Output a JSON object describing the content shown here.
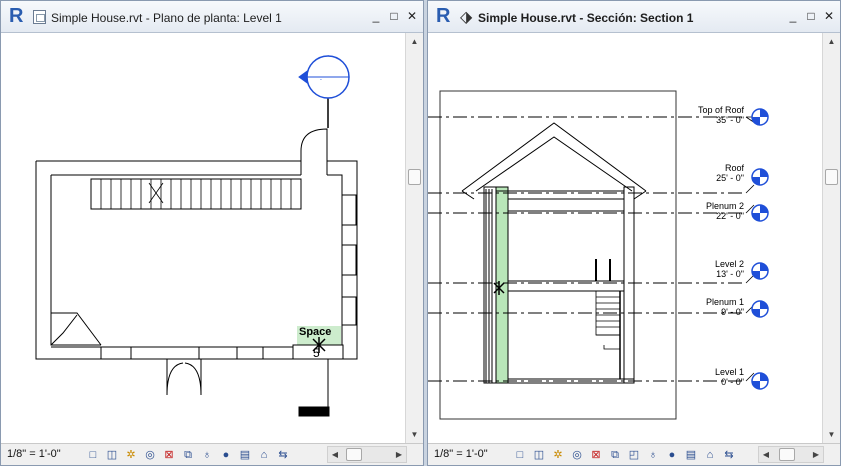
{
  "app": {
    "logo": "R"
  },
  "left_window": {
    "title_file": "Simple House.rvt",
    "title_sep": " - ",
    "title_view": "Plano de planta: Level 1",
    "space_label": "Space",
    "space_number": "5",
    "scale": "1/8\" = 1'-0\""
  },
  "right_window": {
    "title_file": "Simple House.rvt",
    "title_sep": " - ",
    "title_view": "Sección: Section 1",
    "scale": "1/8\" = 1'-0\"",
    "levels": [
      {
        "name": "Top of Roof",
        "elevation": "35' - 0\""
      },
      {
        "name": "Roof",
        "elevation": "25' - 0\""
      },
      {
        "name": "Plenum 2",
        "elevation": "22' - 0\""
      },
      {
        "name": "Level 2",
        "elevation": "13' - 0\""
      },
      {
        "name": "Plenum 1",
        "elevation": "9' - 0\""
      },
      {
        "name": "Level 1",
        "elevation": "0' - 0\""
      }
    ]
  },
  "window_controls": {
    "minimize": "_",
    "maximize": "□",
    "close": "✕"
  },
  "icons": {
    "detail_level": "detail-level-icon",
    "visual_style": "visual-style-icon",
    "sun_path": "sun-path-icon",
    "shadows": "shadows-icon",
    "crop_view": "crop-view-icon",
    "show_crop": "show-crop-region-icon",
    "unlock_3d": "unlocked-view-icon",
    "temporary_hide": "temporary-hide-icon",
    "reveal_hidden": "reveal-hidden-icon",
    "worksharing": "worksharing-display-icon",
    "analytical": "analytical-model-icon",
    "highlight": "highlight-displacement-icon"
  },
  "colors": {
    "accent_blue": "#1f4fd8",
    "space_fill": "#cdeccd",
    "wall_green": "#b9e6b9"
  }
}
